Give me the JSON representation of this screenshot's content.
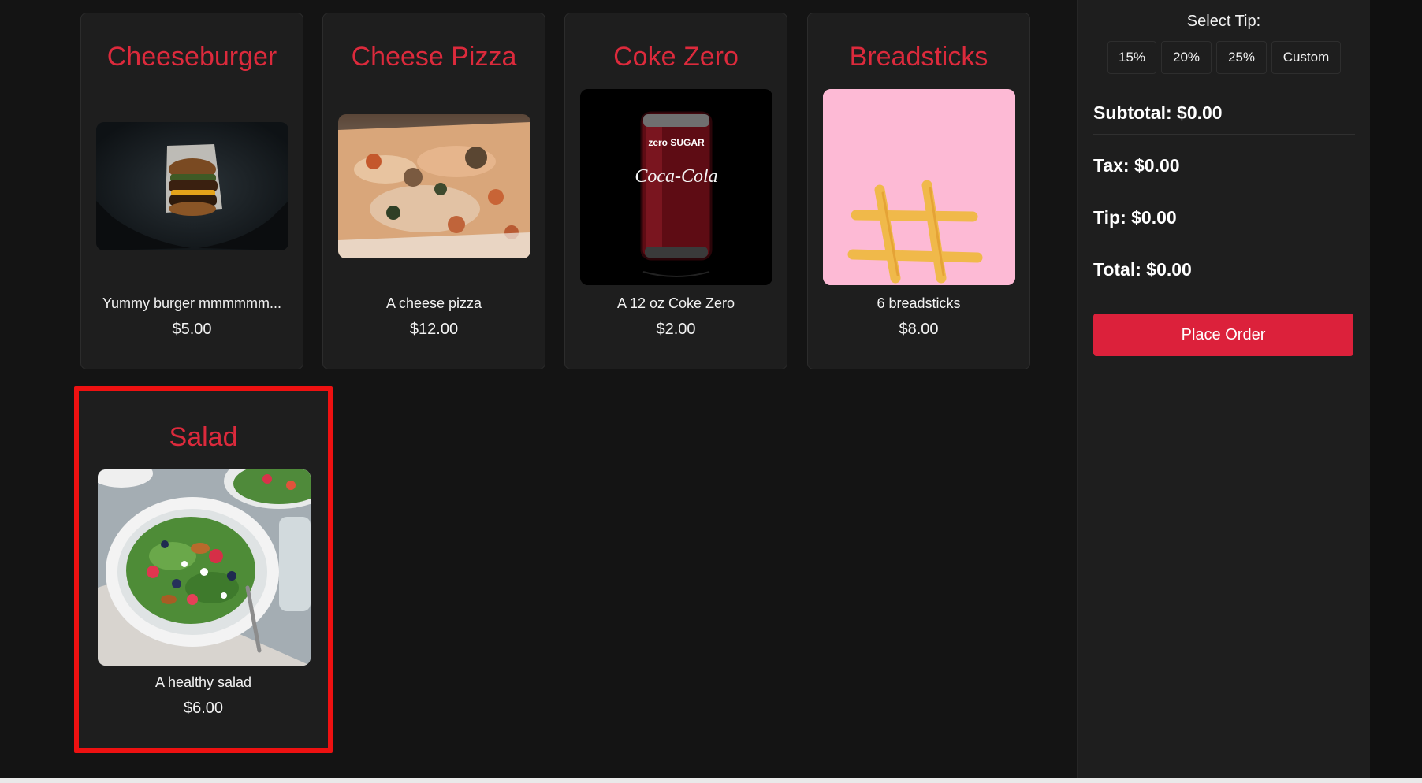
{
  "menu": {
    "items": [
      {
        "name": "Cheeseburger",
        "description": "Yummy burger mmmmmm...",
        "price": "$5.00",
        "image": "burger-photo"
      },
      {
        "name": "Cheese Pizza",
        "description": "A cheese pizza",
        "price": "$12.00",
        "image": "pizza-photo"
      },
      {
        "name": "Coke Zero",
        "description": "A 12 oz Coke Zero",
        "price": "$2.00",
        "image": "coke-can-photo",
        "can_text_top": "zero SUGAR",
        "can_text_brand": "Coca-Cola"
      },
      {
        "name": "Breadsticks",
        "description": "6 breadsticks",
        "price": "$8.00",
        "image": "breadsticks-photo"
      },
      {
        "name": "Salad",
        "description": "A healthy salad",
        "price": "$6.00",
        "image": "salad-photo"
      }
    ],
    "selected_item": "Salad"
  },
  "sidebar": {
    "tip_label": "Select Tip:",
    "tip_options": [
      "15%",
      "20%",
      "25%",
      "Custom"
    ],
    "subtotal": "Subtotal: $0.00",
    "tax": "Tax: $0.00",
    "tip": "Tip: $0.00",
    "total": "Total: $0.00",
    "place_order_label": "Place Order"
  },
  "colors": {
    "accent": "#dc213b",
    "title_red": "#dc2a3c",
    "selection_outline": "#ee1111",
    "background": "#141414",
    "card_background": "#1e1e1e"
  }
}
